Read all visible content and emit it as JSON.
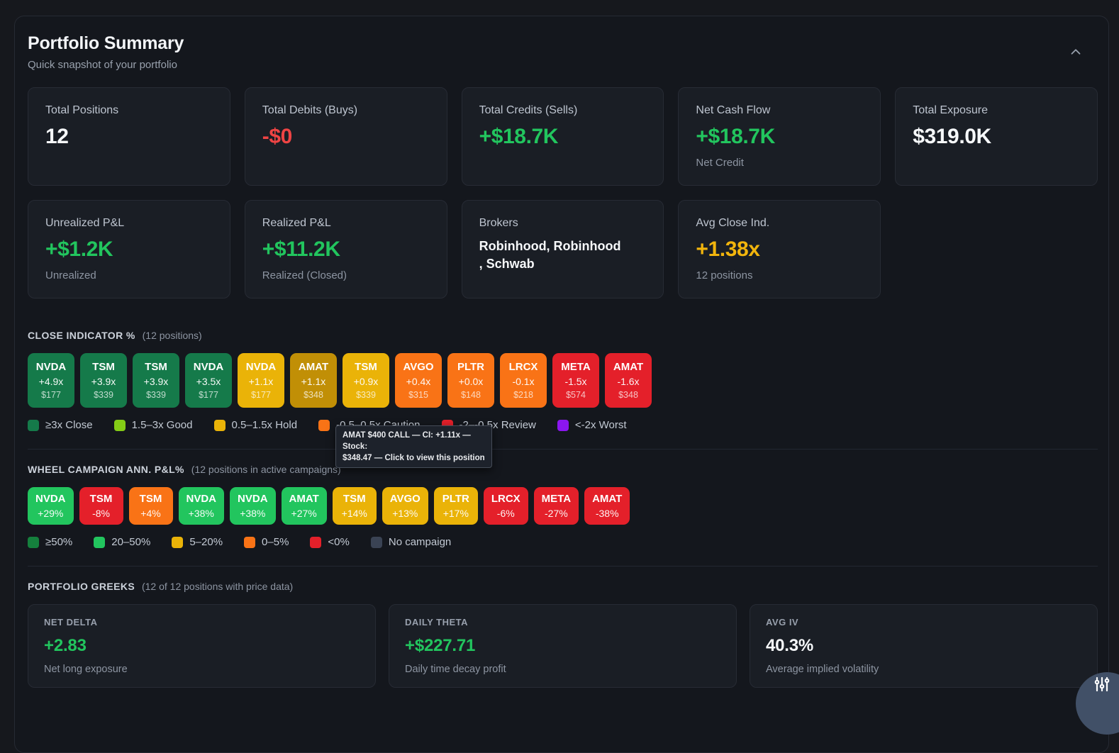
{
  "header": {
    "title": "Portfolio Summary",
    "subtitle": "Quick snapshot of your portfolio"
  },
  "tones": {
    "white": "#f6f8fa",
    "green": "#22c55e",
    "red": "#ef4444",
    "amber": "#f2b50d"
  },
  "tier_colors": {
    "close": "#157a4a",
    "good": "#84cc16",
    "hold": "#eab308",
    "hold_hover": "#c18f06",
    "caution": "#f97316",
    "review": "#e4202a",
    "worst": "#8b16f0",
    "ge50": "#15803d",
    "g20_50": "#22c55e",
    "mid": "#eab308",
    "low": "#f97316",
    "neg": "#e4202a",
    "none": "#3a4354"
  },
  "stats": [
    {
      "label": "Total Positions",
      "value": "12",
      "tone": "white"
    },
    {
      "label": "Total Debits (Buys)",
      "value": "-$0",
      "tone": "red"
    },
    {
      "label": "Total Credits (Sells)",
      "value": "+$18.7K",
      "tone": "green"
    },
    {
      "label": "Net Cash Flow",
      "value": "+$18.7K",
      "tone": "green",
      "sub": "Net Credit"
    },
    {
      "label": "Total Exposure",
      "value": "$319.0K",
      "tone": "white"
    },
    {
      "label": "Unrealized P&L",
      "value": "+$1.2K",
      "tone": "green",
      "sub": "Unrealized"
    },
    {
      "label": "Realized P&L",
      "value": "+$11.2K",
      "tone": "green",
      "sub": "Realized (Closed)"
    },
    {
      "label": "Brokers",
      "value": "Robinhood, Robinhood , Schwab",
      "tone": "white",
      "variant": "text"
    },
    {
      "label": "Avg Close Ind.",
      "value": "+1.38x",
      "tone": "amber",
      "sub": "12 positions"
    }
  ],
  "close_indicator": {
    "heading": "CLOSE INDICATOR %",
    "count_note": "(12 positions)",
    "tiles": [
      {
        "ticker": "NVDA",
        "value": "+4.9x",
        "price": "$177",
        "tier": "close"
      },
      {
        "ticker": "TSM",
        "value": "+3.9x",
        "price": "$339",
        "tier": "close"
      },
      {
        "ticker": "TSM",
        "value": "+3.9x",
        "price": "$339",
        "tier": "close"
      },
      {
        "ticker": "NVDA",
        "value": "+3.5x",
        "price": "$177",
        "tier": "close"
      },
      {
        "ticker": "NVDA",
        "value": "+1.1x",
        "price": "$177",
        "tier": "hold"
      },
      {
        "ticker": "AMAT",
        "value": "+1.1x",
        "price": "$348",
        "tier": "hold_hover"
      },
      {
        "ticker": "TSM",
        "value": "+0.9x",
        "price": "$339",
        "tier": "hold"
      },
      {
        "ticker": "AVGO",
        "value": "+0.4x",
        "price": "$315",
        "tier": "caution"
      },
      {
        "ticker": "PLTR",
        "value": "+0.0x",
        "price": "$148",
        "tier": "caution"
      },
      {
        "ticker": "LRCX",
        "value": "-0.1x",
        "price": "$218",
        "tier": "caution"
      },
      {
        "ticker": "META",
        "value": "-1.5x",
        "price": "$574",
        "tier": "review"
      },
      {
        "ticker": "AMAT",
        "value": "-1.6x",
        "price": "$348",
        "tier": "review"
      }
    ],
    "legend": [
      {
        "label": "≥3x Close",
        "tier": "close"
      },
      {
        "label": "1.5–3x Good",
        "tier": "good"
      },
      {
        "label": "0.5–1.5x Hold",
        "tier": "hold"
      },
      {
        "label": "-0.5–0.5x Caution",
        "tier": "caution"
      },
      {
        "label": "-2–-0.5x Review",
        "tier": "review"
      },
      {
        "label": "<-2x Worst",
        "tier": "worst"
      }
    ],
    "tooltip": {
      "line1": "AMAT $400 CALL — CI: +1.11x — Stock:",
      "line2": "$348.47 — Click to view this position"
    }
  },
  "wheel_campaign": {
    "heading": "WHEEL CAMPAIGN ANN. P&L%",
    "count_note": "(12 positions in active campaigns)",
    "tiles": [
      {
        "ticker": "NVDA",
        "value": "+29%",
        "tier": "g20_50"
      },
      {
        "ticker": "TSM",
        "value": "-8%",
        "tier": "neg"
      },
      {
        "ticker": "TSM",
        "value": "+4%",
        "tier": "low"
      },
      {
        "ticker": "NVDA",
        "value": "+38%",
        "tier": "g20_50"
      },
      {
        "ticker": "NVDA",
        "value": "+38%",
        "tier": "g20_50"
      },
      {
        "ticker": "AMAT",
        "value": "+27%",
        "tier": "g20_50"
      },
      {
        "ticker": "TSM",
        "value": "+14%",
        "tier": "mid"
      },
      {
        "ticker": "AVGO",
        "value": "+13%",
        "tier": "mid"
      },
      {
        "ticker": "PLTR",
        "value": "+17%",
        "tier": "mid"
      },
      {
        "ticker": "LRCX",
        "value": "-6%",
        "tier": "neg"
      },
      {
        "ticker": "META",
        "value": "-27%",
        "tier": "neg"
      },
      {
        "ticker": "AMAT",
        "value": "-38%",
        "tier": "neg"
      }
    ],
    "legend": [
      {
        "label": "≥50%",
        "tier": "ge50"
      },
      {
        "label": "20–50%",
        "tier": "g20_50"
      },
      {
        "label": "5–20%",
        "tier": "mid"
      },
      {
        "label": "0–5%",
        "tier": "low"
      },
      {
        "label": "<0%",
        "tier": "neg"
      },
      {
        "label": "No campaign",
        "tier": "none"
      }
    ]
  },
  "greeks": {
    "heading": "PORTFOLIO GREEKS",
    "count_note": "(12 of 12 positions with price data)",
    "cards": [
      {
        "label": "NET DELTA",
        "value": "+2.83",
        "tone": "green",
        "sub": "Net long exposure"
      },
      {
        "label": "DAILY THETA",
        "value": "+$227.71",
        "tone": "green",
        "sub": "Daily time decay profit"
      },
      {
        "label": "AVG IV",
        "value": "40.3%",
        "tone": "white",
        "sub": "Average implied volatility"
      }
    ]
  },
  "fab": {
    "icon": "sliders-icon"
  }
}
